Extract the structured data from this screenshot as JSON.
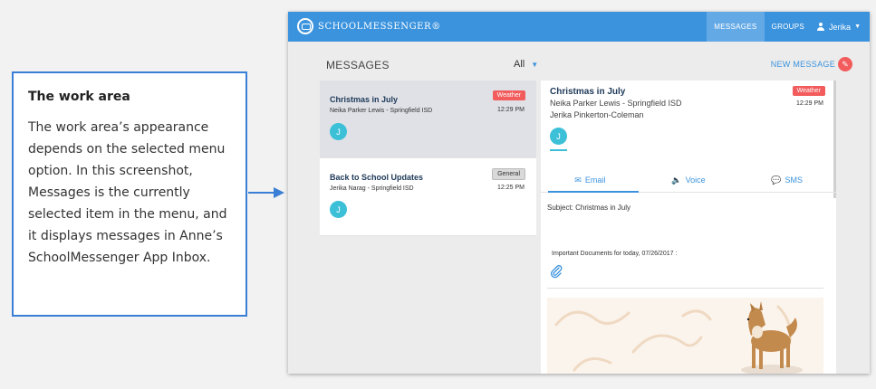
{
  "callout": {
    "title": "The work area",
    "text": "The work area’s appearance depends on the selected menu option. In this screenshot, Messages is the currently selected item in the menu, and it displays messages in Anne’s SchoolMessenger App Inbox."
  },
  "app": {
    "logo_text": "SCHOOLMESSENGER®",
    "nav": [
      {
        "label": "MESSAGES",
        "active": true
      },
      {
        "label": "GROUPS",
        "active": false
      }
    ],
    "user_name": "Jerika",
    "page_title": "MESSAGES",
    "filter_label": "All",
    "new_message_label": "NEW MESSAGE",
    "colors": {
      "brand": "#3b93de",
      "weather_badge": "#f25c5c",
      "avatar": "#3cc0d8"
    }
  },
  "messages": [
    {
      "title": "Christmas in July",
      "sender": "Neika Parker Lewis - Springfield ISD",
      "badge": "Weather",
      "time": "12:29 PM",
      "avatar": "J"
    },
    {
      "title": "Back to School Updates",
      "sender": "Jerika Narag - Springfield ISD",
      "badge": "General",
      "time": "12:25 PM",
      "avatar": "J"
    }
  ],
  "detail": {
    "title": "Christmas in July",
    "sender": "Neika Parker Lewis - Springfield ISD",
    "recipient": "Jerika Pinkerton-Coleman",
    "badge": "Weather",
    "time": "12:29 PM",
    "avatar": "J",
    "tabs": [
      {
        "label": "Email",
        "icon": "envelope-icon"
      },
      {
        "label": "Voice",
        "icon": "speaker-icon"
      },
      {
        "label": "SMS",
        "icon": "chat-bubble-icon"
      }
    ],
    "subject": "Subject: Christmas in July",
    "body": "Important Documents for today,  07/26/2017 :"
  }
}
